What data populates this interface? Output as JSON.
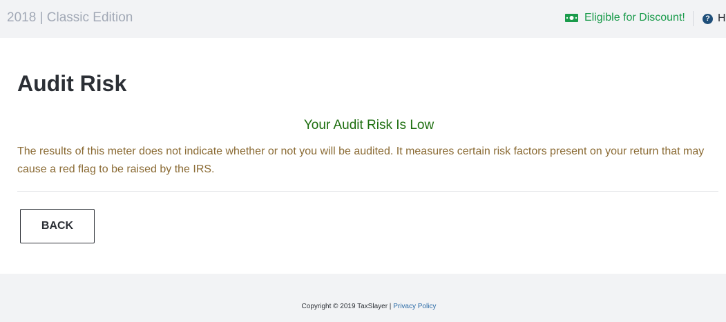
{
  "header": {
    "edition": "2018 | Classic Edition",
    "discount_label": "Eligible for Discount!",
    "discount_icon": "money-icon",
    "help_label": "H",
    "help_icon": "question-circle-icon"
  },
  "main": {
    "title": "Audit Risk",
    "risk_status": "Your Audit Risk Is Low",
    "description": "The results of this meter does not indicate whether or not you will be audited. It measures certain risk factors present on your return that may cause a red flag to be raised by the IRS.",
    "back_label": "BACK"
  },
  "footer": {
    "copyright": "Copyright © 2019 TaxSlayer",
    "separator": " | ",
    "privacy_label": "Privacy Policy"
  },
  "colors": {
    "top_bar_bg": "#f2f3f5",
    "discount_green": "#1a9b4b",
    "risk_status_green": "#1d6e0f",
    "description_text": "#8a6a33",
    "link_blue": "#2a6aa6",
    "help_icon_blue": "#1f4f7a"
  }
}
